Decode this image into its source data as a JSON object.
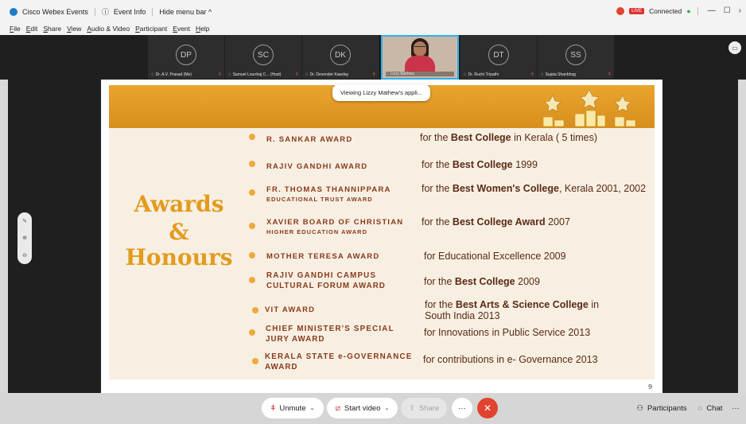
{
  "titlebar": {
    "app_name": "Cisco Webex Events",
    "event_info": "Event Info",
    "hide_menu": "Hide menu bar ^",
    "live": "LIVE",
    "connected": "Connected"
  },
  "menu": [
    "File",
    "Edit",
    "Share",
    "View",
    "Audio & Video",
    "Participant",
    "Event",
    "Help"
  ],
  "participants": [
    {
      "initials": "DP",
      "name": "Dr. A.V. Prasad (Me)"
    },
    {
      "initials": "SC",
      "name": "Samuel Lourdraj C... (Host)"
    },
    {
      "initials": "DK",
      "name": "Dr. Devender Kawday"
    },
    {
      "initials": "",
      "name": "Lizzy Mathew"
    },
    {
      "initials": "DT",
      "name": "Dr. Ruchi Tripathi"
    },
    {
      "initials": "SS",
      "name": "Sujata Shanbhag"
    }
  ],
  "viewing_notice": "Viewing Lizzy Mathew's appli...",
  "slide": {
    "heading_1": "Awards",
    "heading_2": "&",
    "heading_3": "Honours",
    "page": "9",
    "awards": [
      {
        "name": "R. SANKAR AWARD",
        "sub": "",
        "desc_pre": "for the ",
        "desc_bold": "Best College",
        "desc_post": " in Kerala ( 5 times)"
      },
      {
        "name": "RAJIV GANDHI  AWARD",
        "sub": "",
        "desc_pre": "for the ",
        "desc_bold": "Best College",
        "desc_post": " 1999"
      },
      {
        "name": "FR. THOMAS THANNIPPARA",
        "sub": "EDUCATIONAL TRUST AWARD",
        "desc_pre": "for the ",
        "desc_bold": "Best Women's College",
        "desc_post": ", Kerala 2001, 2002"
      },
      {
        "name": "XAVIER BOARD OF CHRISTIAN",
        "sub": "HIGHER EDUCATION AWARD",
        "desc_pre": "for the ",
        "desc_bold": "Best College Award",
        "desc_post": " 2007"
      },
      {
        "name": "MOTHER TERESA AWARD",
        "sub": "",
        "desc_pre": "for Educational Excellence 2009",
        "desc_bold": "",
        "desc_post": ""
      },
      {
        "name": "RAJIV GANDHI CAMPUS",
        "sub": "CULTURAL FORUM AWARD",
        "desc_pre": "for the ",
        "desc_bold": "Best College",
        "desc_post": " 2009"
      },
      {
        "name": "VIT AWARD",
        "sub": "",
        "desc_pre": "for the ",
        "desc_bold": "Best Arts & Science College",
        "desc_post": " in South India 2013"
      },
      {
        "name": "CHIEF MINISTER'S SPECIAL",
        "sub": "JURY AWARD",
        "desc_pre": "for Innovations in Public Service 2013",
        "desc_bold": "",
        "desc_post": ""
      },
      {
        "name": "KERALA STATE e-GOVERNANCE",
        "sub": "AWARD",
        "desc_pre": "for contributions in e- Governance 2013",
        "desc_bold": "",
        "desc_post": ""
      }
    ]
  },
  "bottombar": {
    "unmute": "Unmute",
    "start_video": "Start video",
    "share": "Share",
    "more": "···",
    "participants": "Participants",
    "chat": "Chat",
    "overflow": "···"
  }
}
